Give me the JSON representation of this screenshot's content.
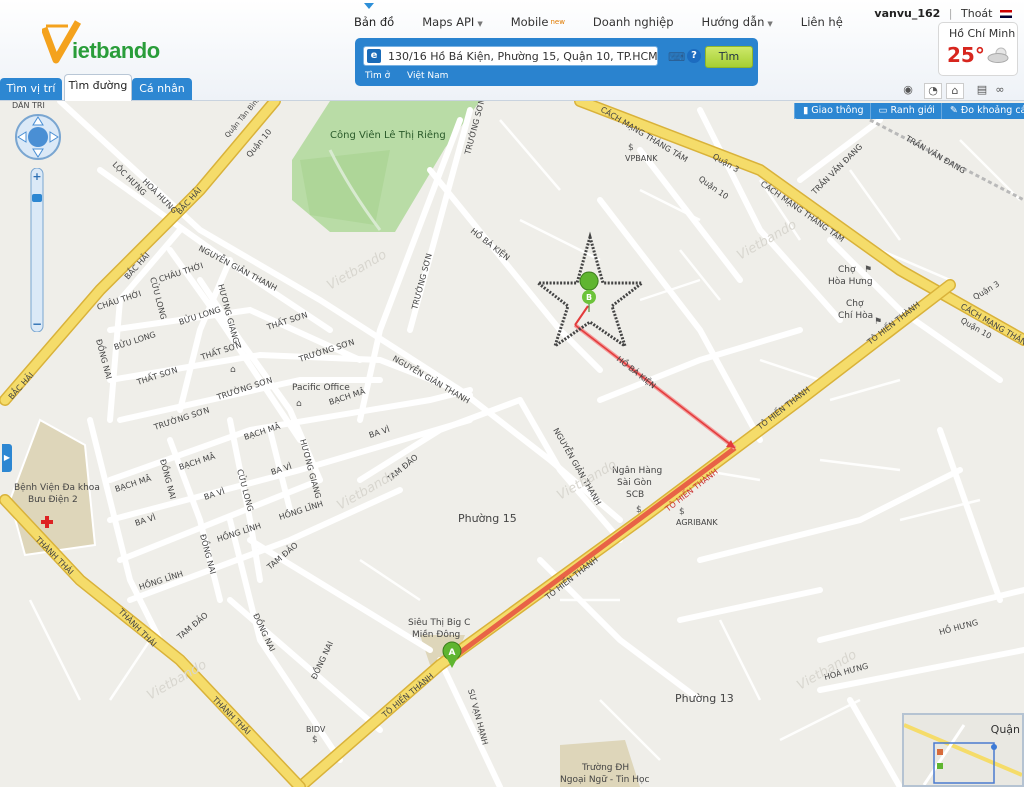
{
  "header": {
    "logo": {
      "text": "ietbando",
      "mark_letter": "V"
    },
    "nav": [
      {
        "label": "Bản đồ",
        "active": true
      },
      {
        "label": "Maps API",
        "dropdown": true
      },
      {
        "label": "Mobile",
        "badge": "new"
      },
      {
        "label": "Doanh nghiệp"
      },
      {
        "label": "Hướng dẫn",
        "dropdown": true
      },
      {
        "label": "Liên hệ"
      }
    ],
    "user": {
      "name": "vanvu_162",
      "logout": "Thoát",
      "separator": "|"
    },
    "weather": {
      "city": "Hồ Chí Minh",
      "temp": "25°"
    }
  },
  "search": {
    "value": "130/16 Hồ Bá Kiện, Phường 15, Quận 10, TP.HCM",
    "button": "Tìm",
    "scope_label": "Tìm ở",
    "scope_value": "Việt Nam"
  },
  "tabs": [
    {
      "label": "Tìm vị trí",
      "active": false
    },
    {
      "label": "Tìm đường",
      "active": true
    },
    {
      "label": "Cá nhân",
      "active": false
    }
  ],
  "map_tools": [
    "Giao thông",
    "Ranh giới",
    "Đo khoảng cách"
  ],
  "map": {
    "labels": {
      "park": "Công Viên Lê Thị Riêng",
      "cmt8": "CÁCH MẠNG THÁNG TÁM",
      "tht": "TÔ HIẾN THÀNH",
      "thanh_thai": "THÀNH THÁI",
      "ho_ba_kien": "HỒ BÁ KIỆN",
      "nguyen_giang_thanh": "NGUYỄN GIẢN THANH",
      "truong_son": "TRƯỜNG SƠN",
      "bac_hai": "BẮC HẢI",
      "ba_vi": "BA VÌ",
      "bach_ma": "BẠCH MÃ",
      "cuu_long": "CỬU LONG",
      "dong_nai": "ĐỒNG NAI",
      "hong_linh": "HỒNG LĨNH",
      "tam_dao": "TAM ĐẢO",
      "huong_giang": "HƯƠNG GIANG",
      "that_son": "THẤT SƠN",
      "buu_long": "BỬU LONG",
      "chau_thoi": "CHÂU THỚI",
      "loc_hung": "LỘC HƯNG",
      "hoa_hung": "HOÀ HƯNG",
      "ho_hung": "HỒ HƯNG",
      "su_van_hanh": "SƯ VẠN HẠNH",
      "tran_van_dang": "TRẦN VĂN ĐANG",
      "dan_tri": "DÂN TRI",
      "quan10": "Quận 10",
      "quan3": "Quận 3",
      "quan_tan_binh": "Quận Tân Bình",
      "phuong15": "Phường 15",
      "phuong13": "Phường 13",
      "pacific": "Pacific Office",
      "vpbank": "VPBANK",
      "agribank": "AGRIBANK",
      "bidv": "BIDV",
      "ngan_hang": [
        "Ngân Hàng",
        "Sài Gòn",
        "SCB"
      ],
      "big_c": [
        "Siêu Thị Big C",
        "Miền Đông"
      ],
      "benh_vien": [
        "Bệnh Viện Đa khoa",
        "Bưu Điện 2"
      ],
      "cho_hoa_hung": [
        "Chợ",
        "Hòa Hưng"
      ],
      "cho_chi_hoa": [
        "Chợ",
        "Chí Hòa"
      ],
      "truong_dh": [
        "Trường ĐH",
        "Ngoại Ngữ - Tin Học"
      ],
      "watermark": "Vietbando"
    },
    "markers": [
      {
        "id": "A",
        "label": "A",
        "color": "#5fb530"
      },
      {
        "id": "B",
        "label": "B",
        "color": "#5fb530"
      }
    ],
    "route_color": "#e33b3b",
    "main_road_color": "#f5dc6a"
  },
  "minimap": {
    "label": "Quận"
  }
}
